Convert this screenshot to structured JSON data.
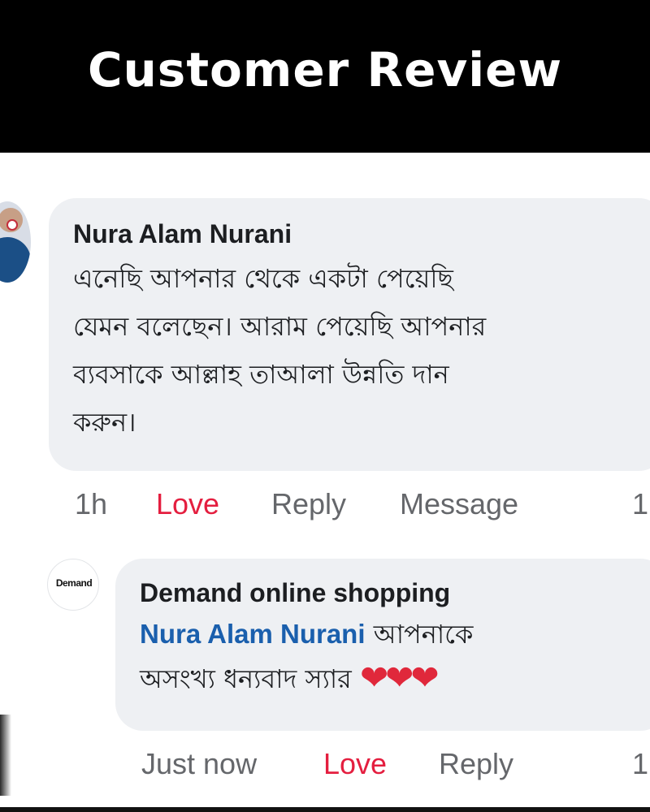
{
  "header": {
    "title": "Customer Review"
  },
  "comment": {
    "author": "Nura Alam Nurani",
    "avatar_icon": "profile-photo",
    "lines": [
      "এনেছি আপনার থেকে একটা পেয়েছি",
      "যেমন বলেছেন। আরাম পেয়েছি আপনার",
      "ব্যবসাকে আল্লাহ তাআলা উন্নতি দান",
      "করুন।"
    ],
    "actions": {
      "time": "1h",
      "love": "Love",
      "reply": "Reply",
      "message": "Message",
      "count": "1"
    }
  },
  "reply": {
    "author": "Demand online shopping",
    "logo_text": "Demand",
    "mention": "Nura Alam Nurani",
    "line1_rest": " আপনাকে",
    "line2": "অসংখ্য ধন্যবাদ স্যার ",
    "hearts": "❤❤❤",
    "actions": {
      "time": "Just now",
      "love": "Love",
      "reply": "Reply",
      "count": "1"
    }
  },
  "colors": {
    "header_bg": "#000000",
    "bubble_bg": "#eef0f3",
    "love": "#e41e3f",
    "mention": "#1a5fad",
    "muted": "#65676b"
  }
}
